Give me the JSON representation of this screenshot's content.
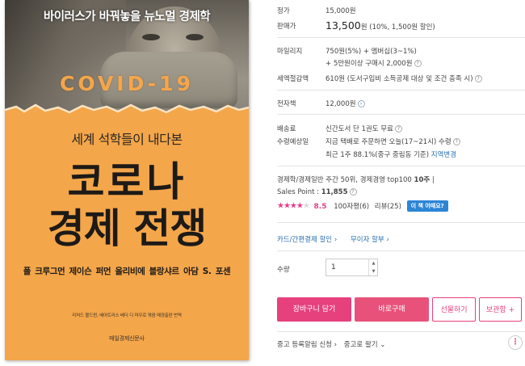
{
  "cover": {
    "top_title": "바이러스가 바꿔놓을 뉴노멀 경제학",
    "covid_label": "COVID-19",
    "subtitle": "세계 석학들이 내다본",
    "title_line1": "코로나",
    "title_line2": "경제 전쟁",
    "authors": "폴 크루그먼  제이슨 퍼먼  올리비에 블랑샤르  아담 S. 포센",
    "editors": "리처드 볼드윈, 베아트리스 베더 디 마우로 엮음  매경출판 번역",
    "publisher": "매일경제신문사",
    "colors": {
      "background": "#f4a64a",
      "title": "#1d1a17"
    }
  },
  "info": {
    "list_price": {
      "label": "정가",
      "value": "15,000원"
    },
    "sale_price": {
      "label": "판매가",
      "amount": "13,500",
      "unit": "원",
      "discount": "(10%, 1,500원 할인)"
    },
    "mileage": {
      "label": "마일리지",
      "line1": "750원(5%) + 멤버십(3~1%)",
      "line2": "+ 5만원이상 구매시 2,000원"
    },
    "tax_deduction": {
      "label": "세액절감액",
      "value": "610원 (도서구입비 소득공제 대상 및 조건 충족 시)"
    },
    "ebook": {
      "label": "전자책",
      "value": "12,000원"
    },
    "shipping_fee": {
      "label": "배송료",
      "value": "신간도서 단 1권도 무료"
    },
    "delivery": {
      "label": "수령예상일",
      "line1_prefix": "지금 택배로 주문하면 ",
      "line1_time": "오늘(17~21시) 수령",
      "line2_prefix": "최근 1주 88.1%(중구 중림동 기준) ",
      "line2_link": "지역변경"
    },
    "ranking": {
      "text": "경제학/경제일반 주간 50위, 경제경영 top100 ",
      "bold": "10주",
      "sep": "  |"
    },
    "sales_point": {
      "label": "Sales Point : ",
      "value": "11,855"
    },
    "rating": {
      "score": "8.5",
      "reviews_100": "100자평(6)",
      "reviews": "리뷰(25)",
      "review_button": "이 책 어때요?"
    },
    "card_discount": "카드/간편결제 할인 ›",
    "interest_free": "무이자 할부 ›",
    "quantity": {
      "label": "수량",
      "value": "1"
    },
    "buttons": {
      "cart": "장바구니 담기",
      "buy": "바로구매",
      "gift": "선물하기",
      "keep": "보관함 +"
    },
    "bottom_links": {
      "restock": "중고 등록알림 신청 ›",
      "sell_used": "중고로 팔기 ⌄"
    },
    "icons": [
      "help-icon",
      "chevron-right-icon",
      "more-dots-icon"
    ],
    "accent_color": "#e6417d"
  }
}
